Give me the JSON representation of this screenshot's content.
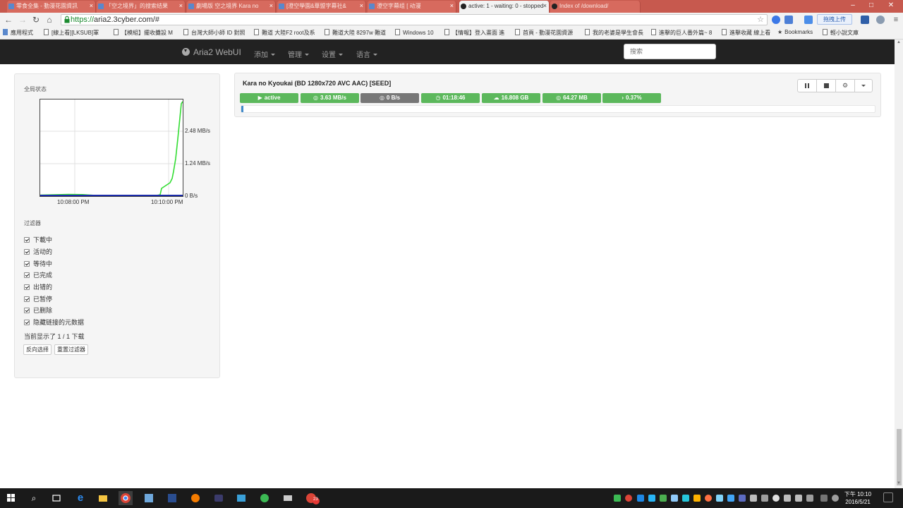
{
  "browser": {
    "tabs": [
      {
        "title": "零食全集 - 動漫花園資訊",
        "active": false
      },
      {
        "title": "「空之境界」的搜索结果",
        "active": false
      },
      {
        "title": "劇場版 空之境界 Kara no",
        "active": false
      },
      {
        "title": "[澄空學園&華盟字幕社&",
        "active": false
      },
      {
        "title": "澄空字幕组 [ 动漫",
        "active": false
      },
      {
        "title": "active: 1 - waiting: 0 - stopped",
        "active": true
      },
      {
        "title": "Index of /download/",
        "active": false
      }
    ],
    "url_scheme": "https://",
    "url_rest": "aria2.3cyber.com/#",
    "upload_button": "拖拽上传",
    "bookmarks": [
      "應用程式",
      "[線上看][LKSUB]軍",
      "【模組】擺收攤設 M",
      "台灣大師小師 ID 對照",
      "難道 大陸F2 root及系",
      "難道大陸 8297w 難道",
      "Windows 10",
      "【情報】登入畫面 進",
      "首頁 - 動漫花園資源",
      "我的老婆是學生會長",
      "進擊的巨人番外篇~ 8",
      "進擊收藏 線上看"
    ],
    "bookmarks_folder": "Bookmarks",
    "bookmarks_extra": "輕小說文庫"
  },
  "navbar": {
    "brand": "Aria2 WebUI",
    "menus": [
      "添加",
      "管理",
      "设置",
      "语言"
    ],
    "search_placeholder": "搜索"
  },
  "sidebar": {
    "global_status_title": "全局状态",
    "graph": {
      "y_labels": [
        "2.48 MB/s",
        "1.24 MB/s",
        "0 B/s"
      ],
      "x_labels": [
        "10:08:00 PM",
        "10:10:00 PM"
      ]
    },
    "filter_title": "过滤器",
    "filters": [
      "下載中",
      "活动的",
      "等待中",
      "已完成",
      "出错的",
      "已暂停",
      "已删除",
      "隐藏链接的元数据"
    ],
    "showing_text": "当前显示了 1 / 1 下载",
    "buttons": {
      "invert": "反向选择",
      "reset": "重置过滤器"
    }
  },
  "download": {
    "name": "Kara no Kyoukai (BD 1280x720 AVC AAC) [SEED]",
    "badges": [
      {
        "icon": "▶",
        "text": "active",
        "color": "green"
      },
      {
        "icon": "◎",
        "text": "3.63 MB/s",
        "color": "green"
      },
      {
        "icon": "◎",
        "text": "0 B/s",
        "color": "gray"
      },
      {
        "icon": "◷",
        "text": "01:18:46",
        "color": "green"
      },
      {
        "icon": "☁",
        "text": "16.808 GB",
        "color": "green"
      },
      {
        "icon": "◎",
        "text": "64.27 MB",
        "color": "green"
      },
      {
        "icon": "›",
        "text": "0.37%",
        "color": "green"
      }
    ],
    "progress_fraction": 0.0037
  },
  "taskbar": {
    "clock_time": "下午 10:10",
    "clock_date": "2016/5/21",
    "badge_count": "23"
  },
  "colors": {
    "tab_strip": "#c7594e",
    "navbar": "#222222",
    "badge_green": "#5cb85c",
    "badge_gray": "#777777",
    "progress": "#428bca",
    "graph_download": "#33dd33",
    "graph_upload": "#1a2aa8"
  }
}
